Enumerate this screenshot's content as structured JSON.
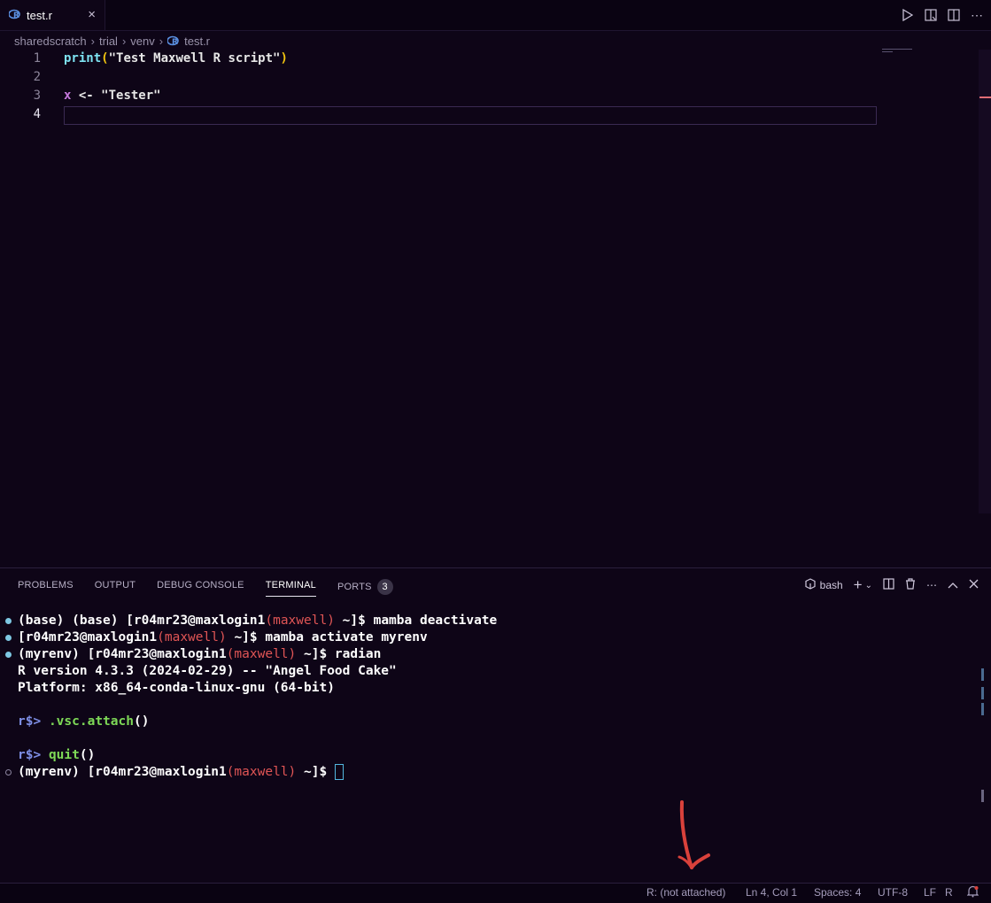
{
  "tab": {
    "filename": "test.r",
    "close_icon": "×",
    "icon": "r-file-icon"
  },
  "tab_actions": [
    "run-icon",
    "open-preview-icon",
    "split-editor-icon",
    "more-actions-icon"
  ],
  "breadcrumb": [
    "sharedscratch",
    "trial",
    "venv",
    "test.r"
  ],
  "editor": {
    "line_numbers": [
      "1",
      "2",
      "3",
      "4"
    ],
    "line1": {
      "fn": "print",
      "open": "(",
      "str": "\"Test Maxwell R script\"",
      "close": ")"
    },
    "line3": {
      "var": "x",
      "op": " <- ",
      "str": "\"Tester\""
    }
  },
  "panel": {
    "tabs": [
      "PROBLEMS",
      "OUTPUT",
      "DEBUG CONSOLE",
      "TERMINAL",
      "PORTS"
    ],
    "ports_badge": "3",
    "shell": "bash",
    "actions": [
      "add-terminal-icon",
      "split-terminal-icon",
      "trash-icon",
      "more-icon",
      "maximize-icon",
      "close-icon"
    ]
  },
  "terminal": {
    "l1_pre": "(base) (base) [r04mr23@maxlogin1",
    "l1_host": "(maxwell)",
    "l1_post": " ~]$ mamba deactivate",
    "l2_pre": "[r04mr23@maxlogin1",
    "l2_host": "(maxwell)",
    "l2_post": " ~]$ mamba activate myrenv",
    "l3_pre": "(myrenv) [r04mr23@maxlogin1",
    "l3_host": "(maxwell)",
    "l3_post": " ~]$ radian",
    "l4": "R version 4.3.3 (2024-02-29) -- \"Angel Food Cake\"",
    "l5": "Platform: x86_64-conda-linux-gnu (64-bit)",
    "rprompt": "r$>",
    "cmd1": ".vsc.attach",
    "cmd2": "quit",
    "parens": "()",
    "l8_pre": "(myrenv) [r04mr23@maxlogin1",
    "l8_host": "(maxwell)",
    "l8_post": " ~]$ "
  },
  "statusbar": {
    "r_status": "R: (not attached)",
    "position": "Ln 4, Col 1",
    "spaces": "Spaces: 4",
    "encoding": "UTF-8",
    "eol": "LF",
    "language": "R"
  },
  "colors": {
    "accent": "#53b7e0",
    "host": "#e05555",
    "annotation_arrow": "#d9413b"
  }
}
